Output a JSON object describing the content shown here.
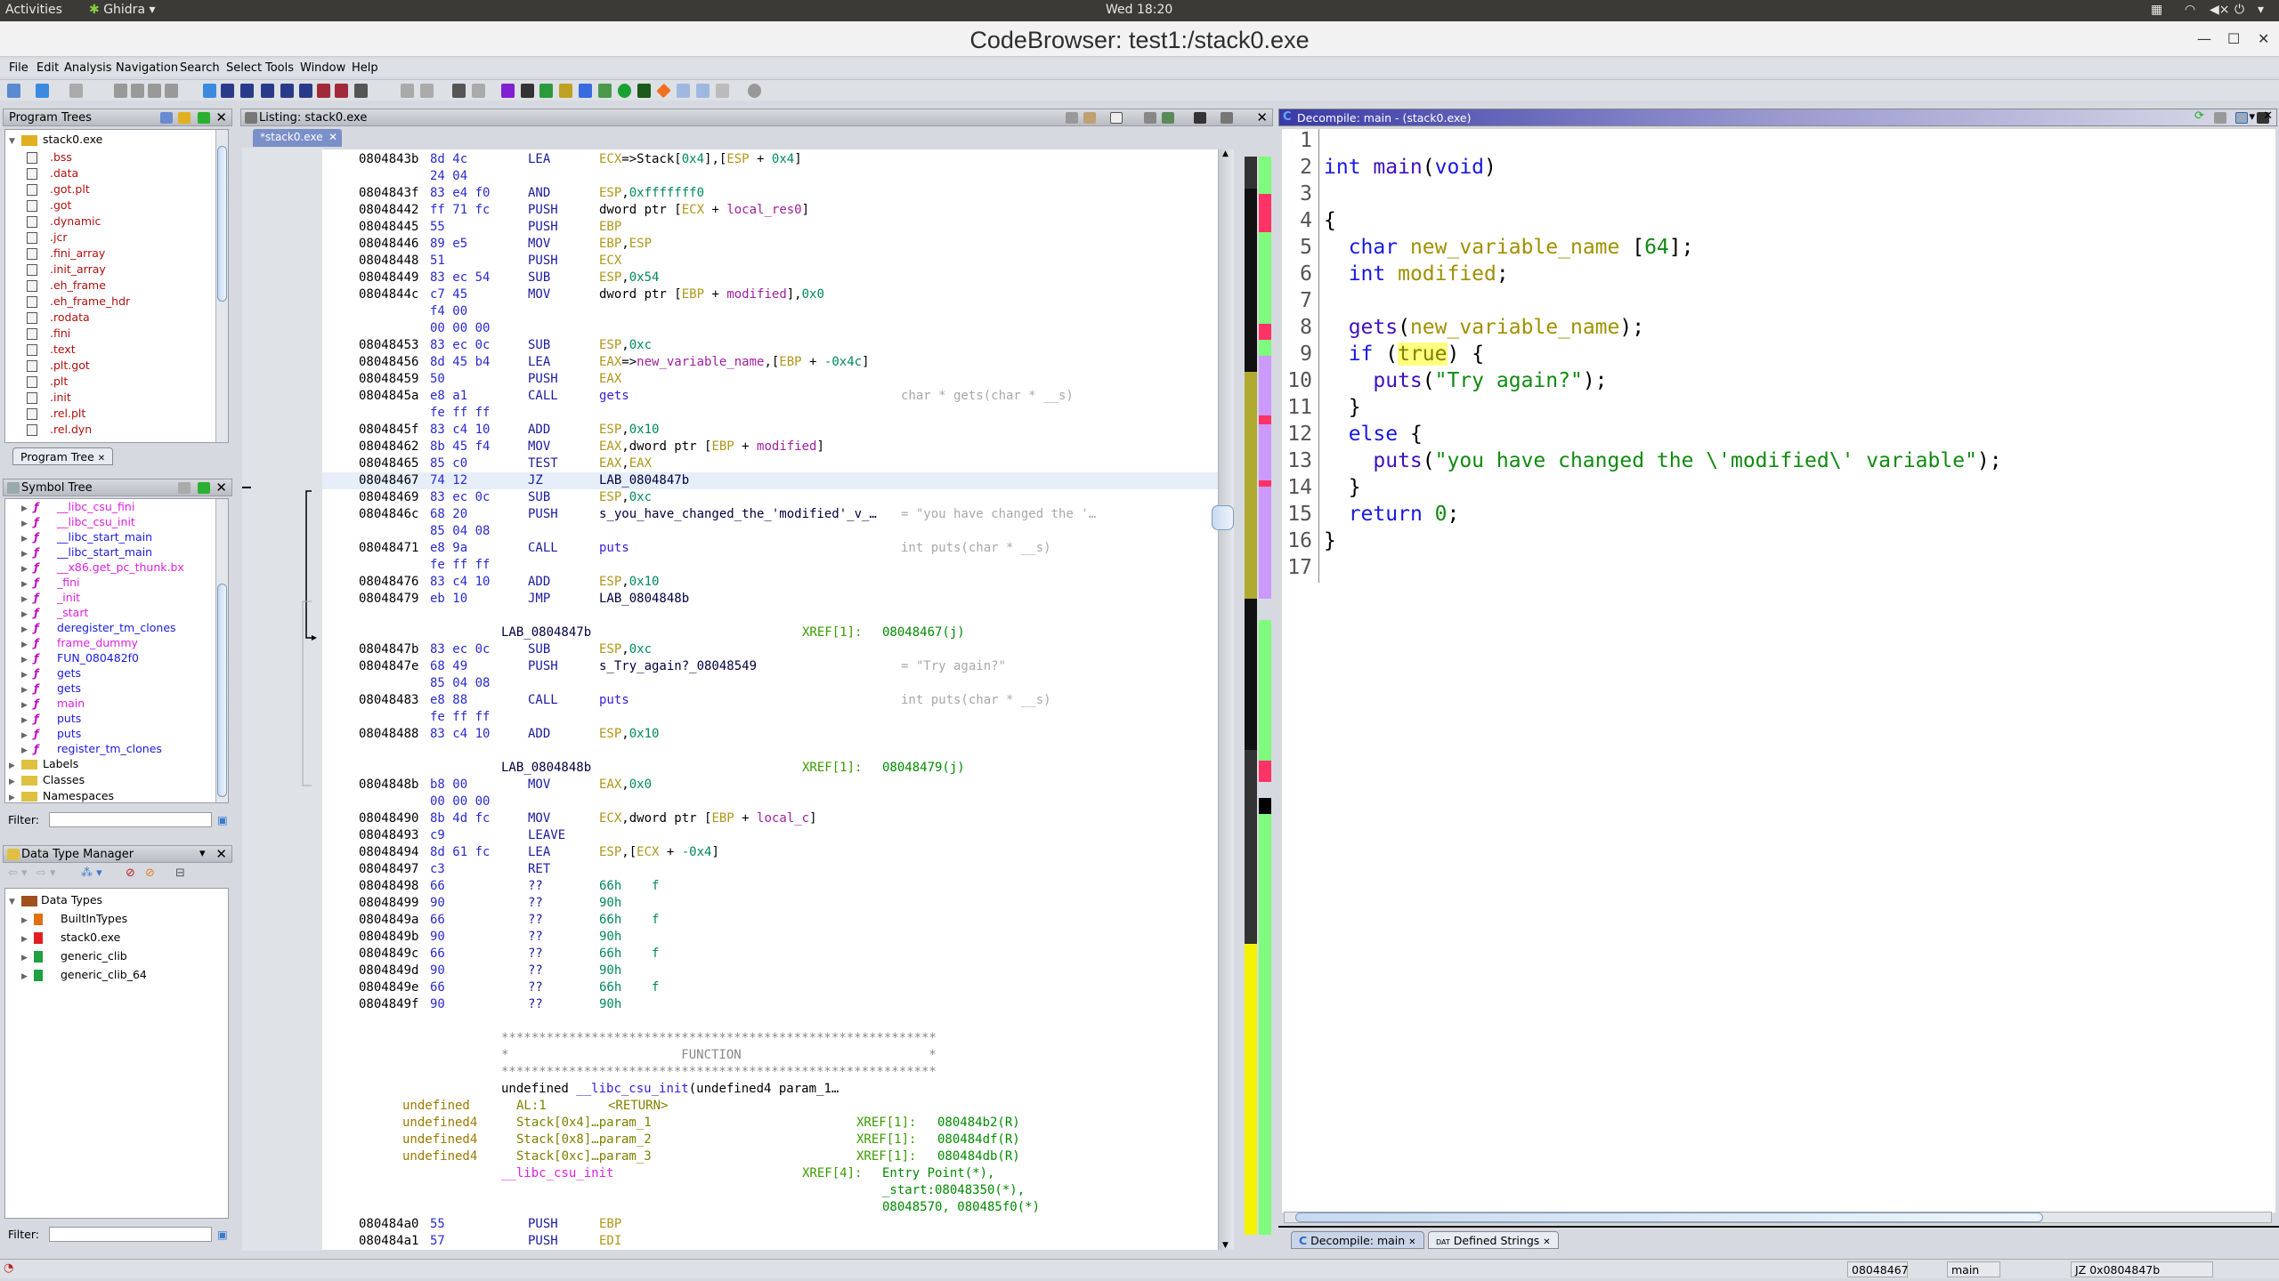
{
  "system_bar": {
    "activities": "Activities",
    "app_menu": "Ghidra",
    "clock": "Wed 18:20"
  },
  "window": {
    "title": "CodeBrowser: test1:/stack0.exe"
  },
  "menu": [
    "File",
    "Edit",
    "Analysis",
    "Navigation",
    "Search",
    "Select",
    "Tools",
    "Window",
    "Help"
  ],
  "program_trees": {
    "title": "Program Trees",
    "root": "stack0.exe",
    "items": [
      ".bss",
      ".data",
      ".got.plt",
      ".got",
      ".dynamic",
      ".jcr",
      ".fini_array",
      ".init_array",
      ".eh_frame",
      ".eh_frame_hdr",
      ".rodata",
      ".fini",
      ".text",
      ".plt.got",
      ".plt",
      ".init",
      ".rel.plt",
      ".rel.dyn"
    ],
    "tab": "Program Tree"
  },
  "symbol_tree": {
    "title": "Symbol Tree",
    "functions": [
      {
        "name": "__libc_csu_fini",
        "color": "#e020e0",
        "thunk": false
      },
      {
        "name": "__libc_csu_init",
        "color": "#e020e0",
        "thunk": false
      },
      {
        "name": "__libc_start_main",
        "color": "#1a1ae0",
        "thunk": true
      },
      {
        "name": "__libc_start_main",
        "color": "#1a1ae0",
        "thunk": true
      },
      {
        "name": "__x86.get_pc_thunk.bx",
        "color": "#e020e0",
        "thunk": false
      },
      {
        "name": "_fini",
        "color": "#e020e0",
        "thunk": false
      },
      {
        "name": "_init",
        "color": "#e020e0",
        "thunk": false
      },
      {
        "name": "_start",
        "color": "#e020e0",
        "thunk": false
      },
      {
        "name": "deregister_tm_clones",
        "color": "#1a1ae0",
        "thunk": false
      },
      {
        "name": "frame_dummy",
        "color": "#e020e0",
        "thunk": false
      },
      {
        "name": "FUN_080482f0",
        "color": "#1a1ae0",
        "thunk": false
      },
      {
        "name": "gets",
        "color": "#1a1ae0",
        "thunk": true
      },
      {
        "name": "gets",
        "color": "#1a1ae0",
        "thunk": true
      },
      {
        "name": "main",
        "color": "#e020e0",
        "thunk": false
      },
      {
        "name": "puts",
        "color": "#1a1ae0",
        "thunk": true
      },
      {
        "name": "puts",
        "color": "#1a1ae0",
        "thunk": true
      },
      {
        "name": "register_tm_clones",
        "color": "#1a1ae0",
        "thunk": false
      }
    ],
    "folders": [
      "Labels",
      "Classes",
      "Namespaces"
    ],
    "filter_label": "Filter:",
    "filter_value": ""
  },
  "data_type_manager": {
    "title": "Data Type Manager",
    "root": "Data Types",
    "items": [
      {
        "name": "BuiltInTypes",
        "color": "#e07010"
      },
      {
        "name": "stack0.exe",
        "color": "#e02020"
      },
      {
        "name": "generic_clib",
        "color": "#20a040"
      },
      {
        "name": "generic_clib_64",
        "color": "#20a040"
      }
    ],
    "filter_label": "Filter:",
    "filter_value": ""
  },
  "listing": {
    "title": "Listing:  stack0.exe",
    "tab": "*stack0.exe",
    "selected_row": 19,
    "rows": [
      {
        "addr": "0804843b",
        "bytes": "8d 4c",
        "mnem": "LEA",
        "ops": [
          [
            "ECX",
            "r"
          ],
          [
            "=>Stack[",
            "p"
          ],
          [
            "0x4",
            "n"
          ],
          [
            "],[",
            "p"
          ],
          [
            "ESP",
            "r"
          ],
          [
            " + ",
            "p"
          ],
          [
            "0x4",
            "n"
          ],
          [
            "]",
            "p"
          ]
        ]
      },
      {
        "bytes": "24 04"
      },
      {
        "addr": "0804843f",
        "bytes": "83 e4 f0",
        "mnem": "AND",
        "ops": [
          [
            "ESP",
            "r"
          ],
          [
            ",",
            "p"
          ],
          [
            "0xfffffff0",
            "n"
          ]
        ]
      },
      {
        "addr": "08048442",
        "bytes": "ff 71 fc",
        "mnem": "PUSH",
        "ops": [
          [
            "dword ptr [",
            "p"
          ],
          [
            "ECX",
            "r"
          ],
          [
            " + ",
            "p"
          ],
          [
            "local_res0",
            "v"
          ],
          [
            "]",
            "p"
          ]
        ]
      },
      {
        "addr": "08048445",
        "bytes": "55",
        "mnem": "PUSH",
        "ops": [
          [
            "EBP",
            "r"
          ]
        ]
      },
      {
        "addr": "08048446",
        "bytes": "89 e5",
        "mnem": "MOV",
        "ops": [
          [
            "EBP",
            "r"
          ],
          [
            ",",
            "p"
          ],
          [
            "ESP",
            "r"
          ]
        ]
      },
      {
        "addr": "08048448",
        "bytes": "51",
        "mnem": "PUSH",
        "ops": [
          [
            "ECX",
            "r"
          ]
        ]
      },
      {
        "addr": "08048449",
        "bytes": "83 ec 54",
        "mnem": "SUB",
        "ops": [
          [
            "ESP",
            "r"
          ],
          [
            ",",
            "p"
          ],
          [
            "0x54",
            "n"
          ]
        ]
      },
      {
        "addr": "0804844c",
        "bytes": "c7 45",
        "mnem": "MOV",
        "ops": [
          [
            "dword ptr [",
            "p"
          ],
          [
            "EBP",
            "r"
          ],
          [
            " + ",
            "p"
          ],
          [
            "modified",
            "v"
          ],
          [
            "],",
            "p"
          ],
          [
            "0x0",
            "n"
          ]
        ]
      },
      {
        "bytes": "f4 00"
      },
      {
        "bytes": "00 00 00"
      },
      {
        "addr": "08048453",
        "bytes": "83 ec 0c",
        "mnem": "SUB",
        "ops": [
          [
            "ESP",
            "r"
          ],
          [
            ",",
            "p"
          ],
          [
            "0xc",
            "n"
          ]
        ]
      },
      {
        "addr": "08048456",
        "bytes": "8d 45 b4",
        "mnem": "LEA",
        "ops": [
          [
            "EAX",
            "r"
          ],
          [
            "=>",
            "p"
          ],
          [
            "new_variable_name",
            "v"
          ],
          [
            ",[",
            "p"
          ],
          [
            "EBP",
            "r"
          ],
          [
            " + ",
            "p"
          ],
          [
            "-0x4c",
            "n"
          ],
          [
            "]",
            "p"
          ]
        ]
      },
      {
        "addr": "08048459",
        "bytes": "50",
        "mnem": "PUSH",
        "ops": [
          [
            "EAX",
            "r"
          ]
        ]
      },
      {
        "addr": "0804845a",
        "bytes": "e8 a1",
        "mnem": "CALL",
        "ops": [
          [
            "gets",
            "f"
          ]
        ],
        "cmt": "char * gets(char * __s)"
      },
      {
        "bytes": "fe ff ff"
      },
      {
        "addr": "0804845f",
        "bytes": "83 c4 10",
        "mnem": "ADD",
        "ops": [
          [
            "ESP",
            "r"
          ],
          [
            ",",
            "p"
          ],
          [
            "0x10",
            "n"
          ]
        ]
      },
      {
        "addr": "08048462",
        "bytes": "8b 45 f4",
        "mnem": "MOV",
        "ops": [
          [
            "EAX",
            "r"
          ],
          [
            ",dword ptr [",
            "p"
          ],
          [
            "EBP",
            "r"
          ],
          [
            " + ",
            "p"
          ],
          [
            "modified",
            "v"
          ],
          [
            "]",
            "p"
          ]
        ]
      },
      {
        "addr": "08048465",
        "bytes": "85 c0",
        "mnem": "TEST",
        "ops": [
          [
            "EAX",
            "r"
          ],
          [
            ",",
            "p"
          ],
          [
            "EAX",
            "r"
          ]
        ]
      },
      {
        "addr": "08048467",
        "bytes": "74 12",
        "mnem": "JZ",
        "ops": [
          [
            "LAB_0804847b",
            "l"
          ]
        ]
      },
      {
        "addr": "08048469",
        "bytes": "83 ec 0c",
        "mnem": "SUB",
        "ops": [
          [
            "ESP",
            "r"
          ],
          [
            ",",
            "p"
          ],
          [
            "0xc",
            "n"
          ]
        ]
      },
      {
        "addr": "0804846c",
        "bytes": "68 20",
        "mnem": "PUSH",
        "ops": [
          [
            "s_you_have_changed_the_'modified'_v_…",
            "l"
          ]
        ],
        "cmt": "= \"you have changed the '…"
      },
      {
        "bytes": "85 04 08"
      },
      {
        "addr": "08048471",
        "bytes": "e8 9a",
        "mnem": "CALL",
        "ops": [
          [
            "puts",
            "f"
          ]
        ],
        "cmt": "int puts(char * __s)"
      },
      {
        "bytes": "fe ff ff"
      },
      {
        "addr": "08048476",
        "bytes": "83 c4 10",
        "mnem": "ADD",
        "ops": [
          [
            "ESP",
            "r"
          ],
          [
            ",",
            "p"
          ],
          [
            "0x10",
            "n"
          ]
        ]
      },
      {
        "addr": "08048479",
        "bytes": "eb 10",
        "mnem": "JMP",
        "ops": [
          [
            "LAB_0804848b",
            "l"
          ]
        ]
      },
      {},
      {
        "label": "LAB_0804847b",
        "xref": "XREF[1]:",
        "xref_value": "08048467(j)"
      },
      {
        "addr": "0804847b",
        "bytes": "83 ec 0c",
        "mnem": "SUB",
        "ops": [
          [
            "ESP",
            "r"
          ],
          [
            ",",
            "p"
          ],
          [
            "0xc",
            "n"
          ]
        ]
      },
      {
        "addr": "0804847e",
        "bytes": "68 49",
        "mnem": "PUSH",
        "ops": [
          [
            "s_Try_again?_08048549",
            "l"
          ]
        ],
        "cmt": "= \"Try again?\""
      },
      {
        "bytes": "85 04 08"
      },
      {
        "addr": "08048483",
        "bytes": "e8 88",
        "mnem": "CALL",
        "ops": [
          [
            "puts",
            "f"
          ]
        ],
        "cmt": "int puts(char * __s)"
      },
      {
        "bytes": "fe ff ff"
      },
      {
        "addr": "08048488",
        "bytes": "83 c4 10",
        "mnem": "ADD",
        "ops": [
          [
            "ESP",
            "r"
          ],
          [
            ",",
            "p"
          ],
          [
            "0x10",
            "n"
          ]
        ]
      },
      {},
      {
        "label": "LAB_0804848b",
        "xref": "XREF[1]:",
        "xref_value": "08048479(j)"
      },
      {
        "addr": "0804848b",
        "bytes": "b8 00",
        "mnem": "MOV",
        "ops": [
          [
            "EAX",
            "r"
          ],
          [
            ",",
            "p"
          ],
          [
            "0x0",
            "n"
          ]
        ]
      },
      {
        "bytes": "00 00 00"
      },
      {
        "addr": "08048490",
        "bytes": "8b 4d fc",
        "mnem": "MOV",
        "ops": [
          [
            "ECX",
            "r"
          ],
          [
            ",dword ptr [",
            "p"
          ],
          [
            "EBP",
            "r"
          ],
          [
            " + ",
            "p"
          ],
          [
            "local_c",
            "v"
          ],
          [
            "]",
            "p"
          ]
        ]
      },
      {
        "addr": "08048493",
        "bytes": "c9",
        "mnem": "LEAVE"
      },
      {
        "addr": "08048494",
        "bytes": "8d 61 fc",
        "mnem": "LEA",
        "ops": [
          [
            "ESP",
            "r"
          ],
          [
            ",[",
            "p"
          ],
          [
            "ECX",
            "r"
          ],
          [
            " + ",
            "p"
          ],
          [
            "-0x4",
            "n"
          ],
          [
            "]",
            "p"
          ]
        ]
      },
      {
        "addr": "08048497",
        "bytes": "c3",
        "mnem": "RET"
      },
      {
        "addr": "08048498",
        "bytes": "66",
        "mnem": "??",
        "ops": [
          [
            "66h",
            "n"
          ],
          [
            "    f",
            "n"
          ]
        ]
      },
      {
        "addr": "08048499",
        "bytes": "90",
        "mnem": "??",
        "ops": [
          [
            "90h",
            "n"
          ]
        ]
      },
      {
        "addr": "0804849a",
        "bytes": "66",
        "mnem": "??",
        "ops": [
          [
            "66h",
            "n"
          ],
          [
            "    f",
            "n"
          ]
        ]
      },
      {
        "addr": "0804849b",
        "bytes": "90",
        "mnem": "??",
        "ops": [
          [
            "90h",
            "n"
          ]
        ]
      },
      {
        "addr": "0804849c",
        "bytes": "66",
        "mnem": "??",
        "ops": [
          [
            "66h",
            "n"
          ],
          [
            "    f",
            "n"
          ]
        ]
      },
      {
        "addr": "0804849d",
        "bytes": "90",
        "mnem": "??",
        "ops": [
          [
            "90h",
            "n"
          ]
        ]
      },
      {
        "addr": "0804849e",
        "bytes": "66",
        "mnem": "??",
        "ops": [
          [
            "66h",
            "n"
          ],
          [
            "    f",
            "n"
          ]
        ]
      },
      {
        "addr": "0804849f",
        "bytes": "90",
        "mnem": "??",
        "ops": [
          [
            "90h",
            "n"
          ]
        ]
      },
      {},
      {
        "stars": "**********************************************************"
      },
      {
        "stars": "*                       FUNCTION                         *"
      },
      {
        "stars": "**********************************************************"
      },
      {
        "signature": [
          [
            "undefined ",
            "p"
          ],
          [
            "__libc_csu_init",
            "f"
          ],
          [
            "(undefined4 param_1…",
            "p"
          ]
        ]
      },
      {
        "type": "undefined",
        "storage": "AL:1",
        "name": "<RETURN>"
      },
      {
        "type": "undefined4",
        "storage": "Stack[0x4]…param_1",
        "pxref": "XREF[1]:",
        "pxref_value": "080484b2(R)"
      },
      {
        "type": "undefined4",
        "storage": "Stack[0x8]…param_2",
        "pxref": "XREF[1]:",
        "pxref_value": "080484df(R)"
      },
      {
        "type": "undefined4",
        "storage": "Stack[0xc]…param_3",
        "pxref": "XREF[1]:",
        "pxref_value": "080484db(R)"
      },
      {
        "fnlabel": "__libc_csu_init",
        "xref": "XREF[4]:",
        "xref_value": "Entry Point(*),"
      },
      {
        "xref_value": "_start:08048350(*),"
      },
      {
        "xref_value": "08048570, 080485f0(*)"
      },
      {
        "addr": "080484a0",
        "bytes": "55",
        "mnem": "PUSH",
        "ops": [
          [
            "EBP",
            "r"
          ]
        ]
      },
      {
        "addr": "080484a1",
        "bytes": "57",
        "mnem": "PUSH",
        "ops": [
          [
            "EDI",
            "r"
          ]
        ]
      }
    ]
  },
  "decompiler": {
    "title": "Decompile: main -  (stack0.exe)",
    "lines": [
      [],
      [
        [
          "int ",
          "kw"
        ],
        [
          "main",
          "fnn"
        ],
        [
          "(",
          "pun"
        ],
        [
          "void",
          "kw"
        ],
        [
          ")",
          "pun"
        ]
      ],
      [],
      [
        [
          "{",
          "pun"
        ]
      ],
      [
        [
          "  ",
          "pun"
        ],
        [
          "char ",
          "kw"
        ],
        [
          "new_variable_name ",
          "var"
        ],
        [
          "[",
          "pun"
        ],
        [
          "64",
          "num"
        ],
        [
          "];",
          "pun"
        ]
      ],
      [
        [
          "  ",
          "pun"
        ],
        [
          "int ",
          "kw"
        ],
        [
          "modified",
          "var"
        ],
        [
          ";",
          "pun"
        ]
      ],
      [],
      [
        [
          "  ",
          "pun"
        ],
        [
          "gets",
          "fnn"
        ],
        [
          "(",
          "pun"
        ],
        [
          "new_variable_name",
          "var"
        ],
        [
          ");",
          "pun"
        ]
      ],
      [
        [
          "  ",
          "pun"
        ],
        [
          "if ",
          "kw"
        ],
        [
          "(",
          "pun"
        ],
        [
          "true",
          "hl"
        ],
        [
          ") {",
          "pun"
        ]
      ],
      [
        [
          "    ",
          "pun"
        ],
        [
          "puts",
          "fnn"
        ],
        [
          "(",
          "pun"
        ],
        [
          "\"Try again?\"",
          "str"
        ],
        [
          ");",
          "pun"
        ]
      ],
      [
        [
          "  }",
          "pun"
        ]
      ],
      [
        [
          "  ",
          "pun"
        ],
        [
          "else ",
          "kw"
        ],
        [
          "{",
          "pun"
        ]
      ],
      [
        [
          "    ",
          "pun"
        ],
        [
          "puts",
          "fnn"
        ],
        [
          "(",
          "pun"
        ],
        [
          "\"you have changed the \\'modified\\' variable\"",
          "str"
        ],
        [
          ");",
          "pun"
        ]
      ],
      [
        [
          "  }",
          "pun"
        ]
      ],
      [
        [
          "  ",
          "pun"
        ],
        [
          "return ",
          "kw"
        ],
        [
          "0",
          "num"
        ],
        [
          ";",
          "pun"
        ]
      ],
      [
        [
          "}",
          "pun"
        ]
      ],
      []
    ]
  },
  "bottom_tabs": [
    "Decompile: main",
    "Defined Strings"
  ],
  "status": {
    "address": "08048467",
    "function": "main",
    "instruction": "JZ 0x0804847b"
  },
  "overview_colors": {
    "code": "#7dfc7d",
    "undefined": "#ff3366",
    "data": "#cc99ff",
    "entropy_dark": "#111111",
    "entropy_olive": "#b0aa30",
    "entropy_yellow": "#f5f200"
  }
}
